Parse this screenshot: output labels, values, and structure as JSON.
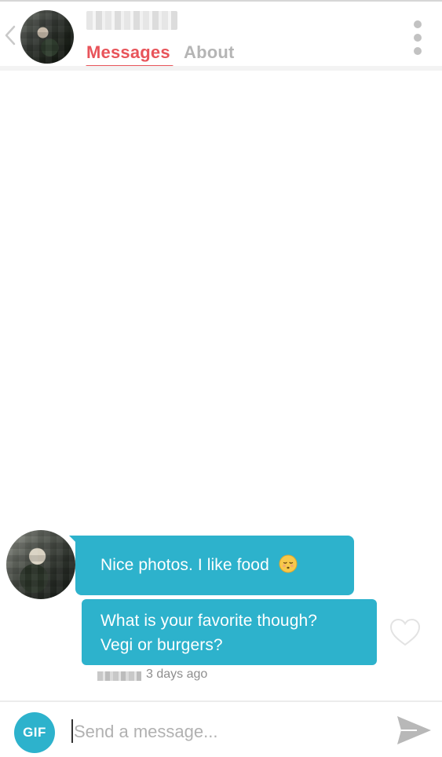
{
  "header": {
    "back_icon": "chevron-left-icon",
    "menu_icon": "kebab-menu-icon",
    "tabs": [
      {
        "label": "Messages",
        "active": true
      },
      {
        "label": "About",
        "active": false
      }
    ],
    "accent_color": "#e8545a"
  },
  "conversation": {
    "messages": [
      {
        "text": "Nice photos. I like food",
        "emoji": "relieved-face-emoji"
      },
      {
        "line1": "What is your favorite though?",
        "line2": "Vegi or burgers?"
      }
    ],
    "timestamp": "3 days ago",
    "bubble_color": "#2db2cc",
    "like_icon": "heart-outline-icon"
  },
  "composer": {
    "gif_label": "GIF",
    "placeholder": "Send a message...",
    "value": "",
    "send_icon": "send-arrow-icon"
  }
}
